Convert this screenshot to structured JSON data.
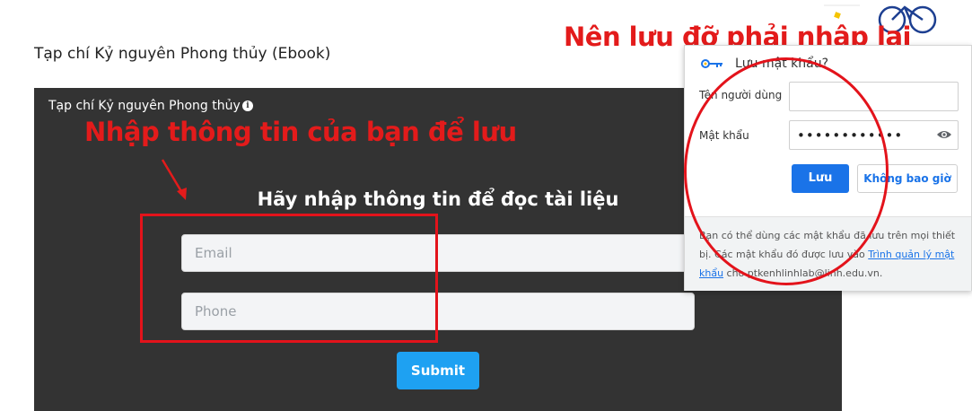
{
  "page": {
    "title": "Tạp chí Kỷ nguyên Phong thủy (Ebook)"
  },
  "embed": {
    "title": "Tạp chí Kỷ nguyên Phong thủy",
    "info_icon": "info-icon",
    "heading": "Hãy nhập thông tin để đọc tài liệu",
    "email_placeholder": "Email",
    "phone_placeholder": "Phone",
    "submit_label": "Submit",
    "background": "#333333",
    "button_color": "#1ea1f2"
  },
  "annotations": {
    "left_text": "Nhập thông tin của bạn để lưu",
    "right_text": "Nên lưu đỡ phải nhập lại",
    "color": "#e31b1b"
  },
  "password_popup": {
    "title": "Lưu mật khẩu?",
    "key_icon": "key-icon",
    "username_label": "Tên người dùng",
    "username_value": "",
    "password_label": "Mật khẩu",
    "password_value": "••••••••••••",
    "eye_icon": "eye-icon",
    "save_label": "Lưu",
    "never_label": "Không bao giờ",
    "footer_text_before": "Bạn có thể dùng các mật khẩu đã lưu trên mọi thiết bị. Các mật khẩu đó được lưu vào ",
    "footer_link": "Trình quản lý mật khẩu",
    "footer_text_after": " cho ptkenhlinhlab@linh.edu.vn.",
    "accent": "#1a73e8"
  }
}
